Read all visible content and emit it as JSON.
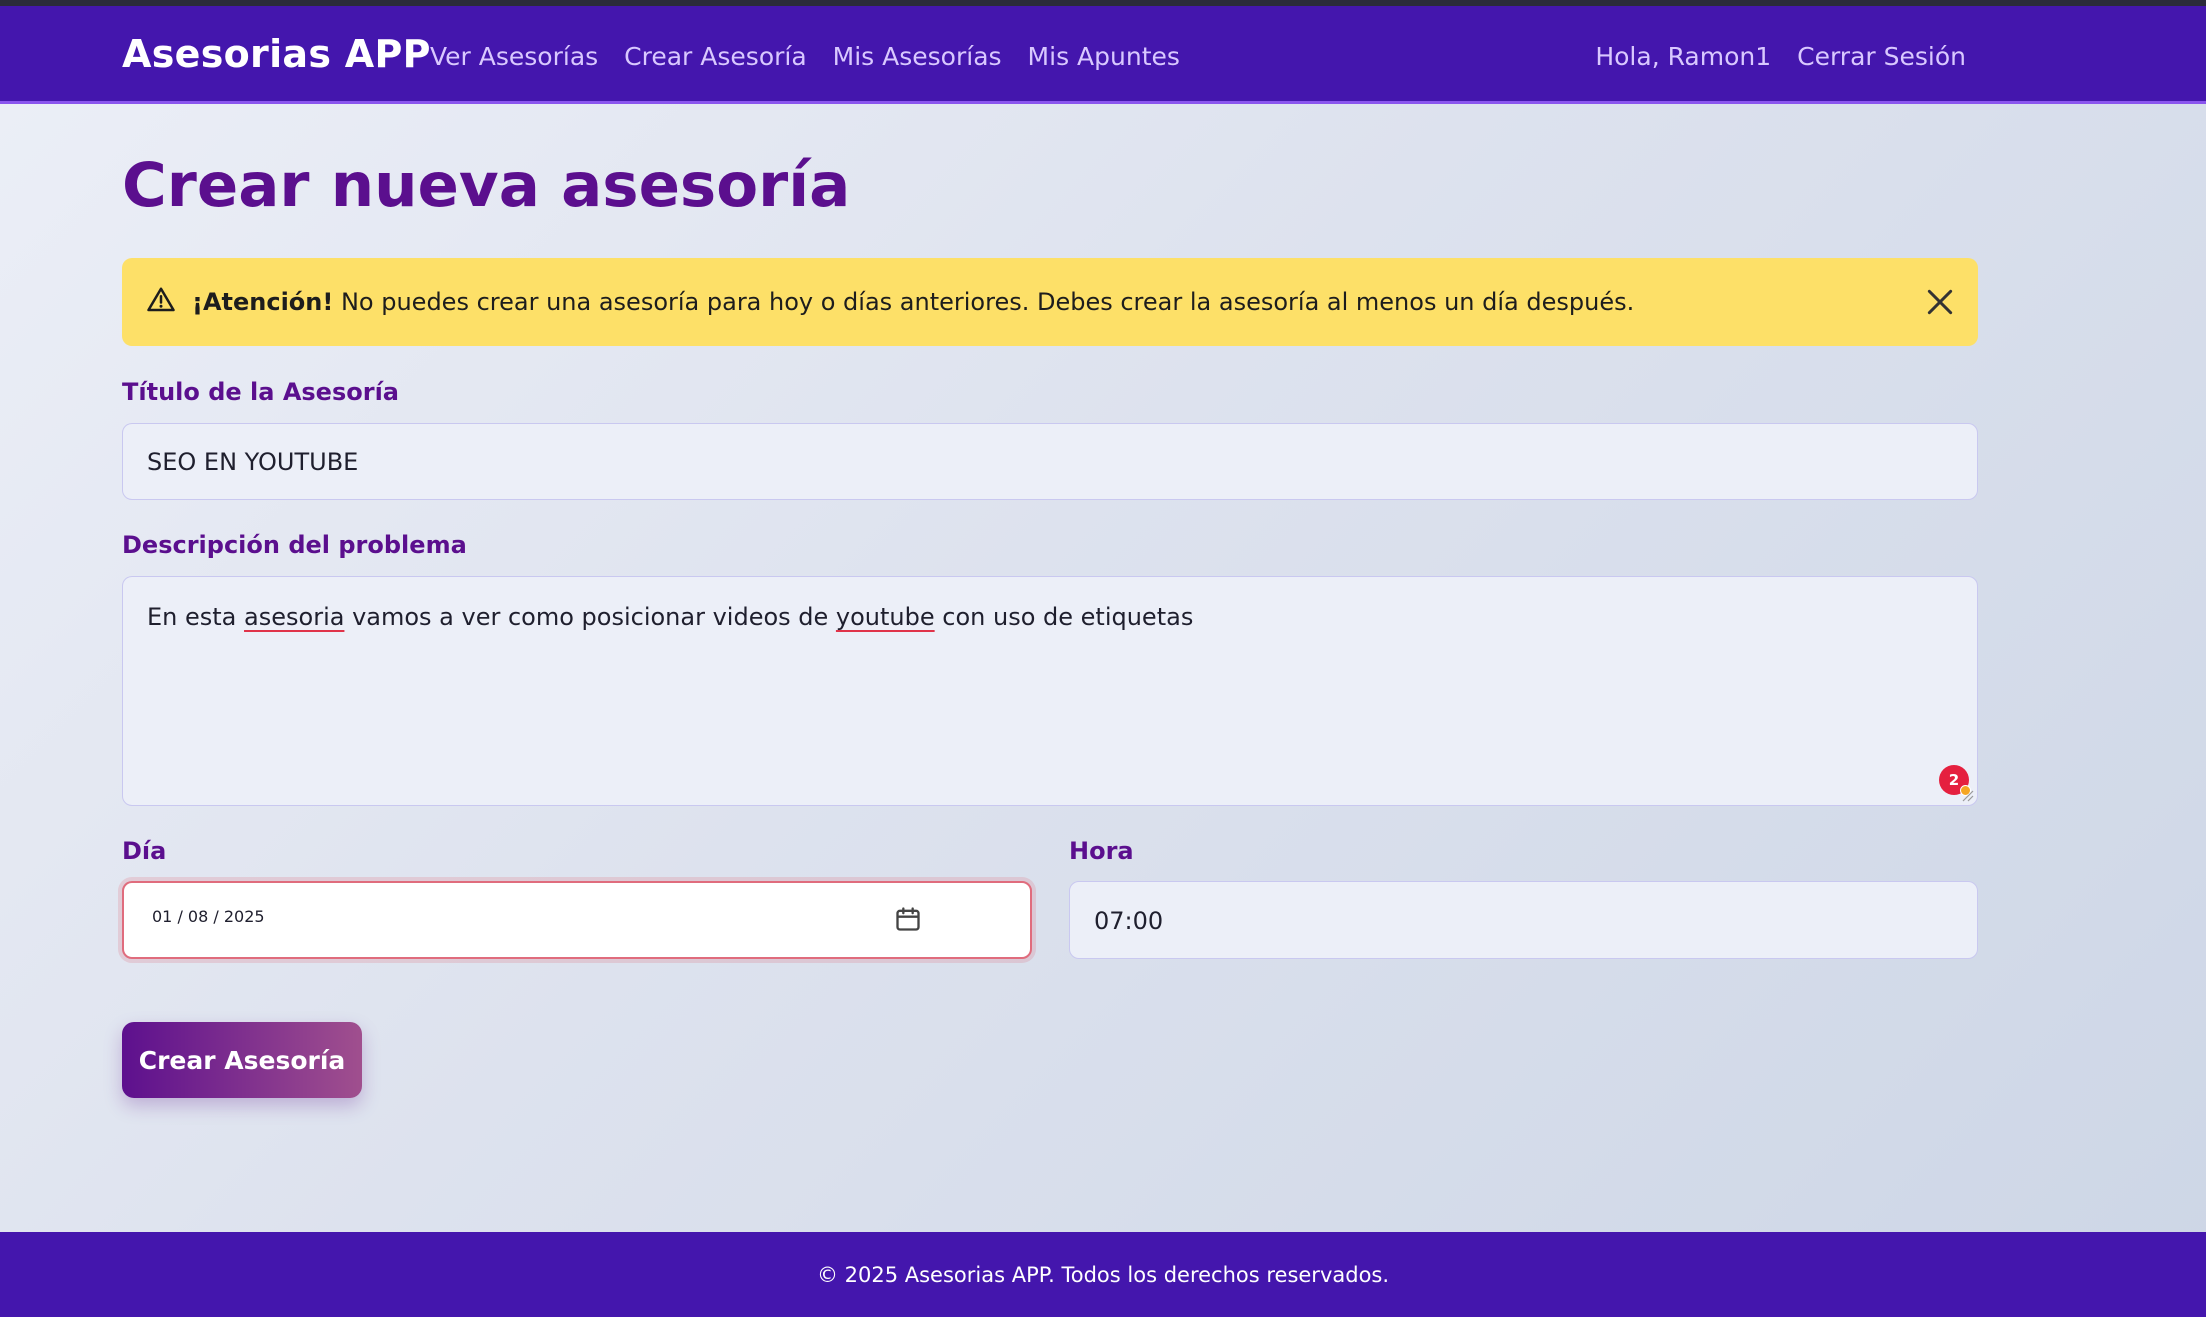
{
  "navbar": {
    "brand": "Asesorias APP",
    "links": [
      "Ver Asesorías",
      "Crear Asesoría",
      "Mis Asesorías",
      "Mis Apuntes"
    ],
    "greeting": "Hola, Ramon1",
    "logout": "Cerrar Sesión",
    "background_color": "#4416ad"
  },
  "page": {
    "title": "Crear nueva asesoría"
  },
  "alert": {
    "strong": "¡Atención!",
    "message": "No puedes crear una asesoría para hoy o días anteriores. Debes crear la asesoría al menos un día después.",
    "background_color": "#fde068",
    "icon": "warning-triangle-icon",
    "close_icon": "close-icon"
  },
  "form": {
    "title_label": "Título de la Asesoría",
    "title_value": "SEO EN YOUTUBE",
    "description_label": "Descripción del problema",
    "description_parts": [
      "En esta ",
      "asesoria",
      " vamos a ver como posicionar videos de ",
      "youtube",
      " con uso de etiquetas"
    ],
    "spelling_badge_count": "2",
    "day_label": "Día",
    "day_value": "01 / 08 / 2025",
    "hour_label": "Hora",
    "hour_value": "07:00",
    "submit_label": "Crear Asesoría"
  },
  "footer": {
    "text": "© 2025 Asesorias APP. Todos los derechos reservados."
  }
}
